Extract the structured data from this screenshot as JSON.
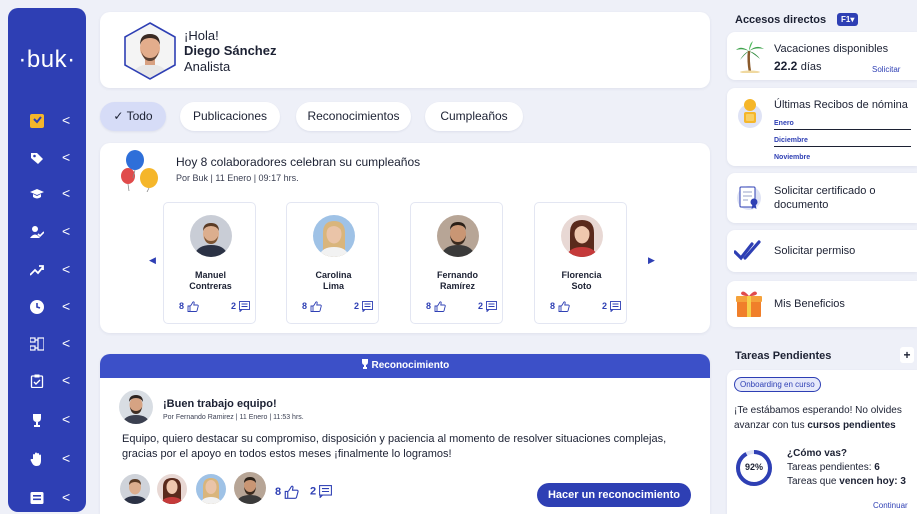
{
  "sidebar": {
    "logo": "·buk·",
    "chevron": "<",
    "items": [
      {
        "icon": "document-icon"
      },
      {
        "icon": "tag-icon"
      },
      {
        "icon": "graduation-cap-icon"
      },
      {
        "icon": "user-check-icon"
      },
      {
        "icon": "trend-up-icon"
      },
      {
        "icon": "clock-icon"
      },
      {
        "icon": "org-chart-icon"
      },
      {
        "icon": "clipboard-check-icon"
      },
      {
        "icon": "trophy-icon"
      },
      {
        "icon": "hand-icon"
      },
      {
        "icon": "id-card-icon"
      }
    ],
    "active_color": "#f5b62a",
    "bg_color": "#2e3fb4"
  },
  "profile": {
    "greeting": "¡Hola!",
    "name": "Diego Sánchez",
    "role": "Analista"
  },
  "tabs": [
    {
      "label": "Todo",
      "check": "✓"
    },
    {
      "label": "Publicaciones"
    },
    {
      "label": "Reconocimientos"
    },
    {
      "label": "Cumpleaños"
    }
  ],
  "birthday": {
    "title": "Hoy 8 colaboradores celebran su cumpleaños",
    "meta": "Por Buk | 11 Enero | 09:17 hrs.",
    "people": [
      {
        "name_line1": "Manuel",
        "name_line2": "Contreras",
        "likes": "8",
        "comments": "2"
      },
      {
        "name_line1": "Carolina",
        "name_line2": "Lima",
        "likes": "8",
        "comments": "2"
      },
      {
        "name_line1": "Fernando",
        "name_line2": "Ramírez",
        "likes": "8",
        "comments": "2"
      },
      {
        "name_line1": "Florencia",
        "name_line2": "Soto",
        "likes": "8",
        "comments": "2"
      }
    ]
  },
  "recognition": {
    "header": "Reconocimiento",
    "title": "¡Buen trabajo equipo!",
    "meta": "Por Fernando Ramirez | 11 Enero | 11:53 hrs.",
    "body": "Equipo, quiero destacar su compromiso, disposición y paciencia al momento de resolver situaciones complejas, gracias por el apoyo en todos estos meses ¡finalmente lo logramos!",
    "likes": "8",
    "comments": "2",
    "cta": "Hacer un reconocimiento"
  },
  "shortcuts": {
    "title": "Accesos directos",
    "badge": "F1",
    "vacation": {
      "label": "Vacaciones disponibles",
      "days": "22.2",
      "unit": "días",
      "action": "Solicitar"
    },
    "payslips": {
      "label": "Últimas Recibos de nómina",
      "months": [
        "Enero",
        "Diciembre",
        "Noviembre"
      ]
    },
    "certificate": {
      "label_line1": "Solicitar certificado o",
      "label_line2": "documento"
    },
    "permission": {
      "label": "Solicitar permiso"
    },
    "benefits": {
      "label": "Mis Beneficios"
    }
  },
  "tasks": {
    "title": "Tareas Pendientes",
    "add": "+",
    "badge": "Onboarding en curso",
    "text_line1": "¡Te estábamos esperando! No olvides",
    "text_line2_pre": "avanzar con tus ",
    "text_line2_bold": "cursos pendientes",
    "progress_label": "92%",
    "progress_value": 0.92,
    "question": "¿Cómo vas?",
    "pending_pre": "Tareas pendientes: ",
    "pending_count": "6",
    "due_pre": "Tareas que ",
    "due_bold": "vencen hoy: 3",
    "continue": "Continuar"
  }
}
